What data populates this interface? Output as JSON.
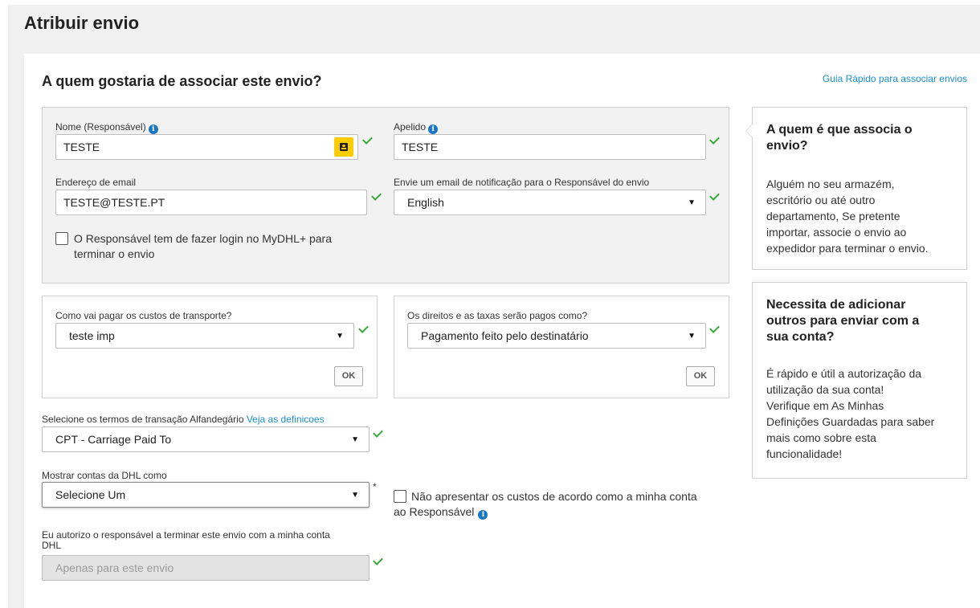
{
  "page": {
    "title": "Atribuir envio"
  },
  "section": {
    "title": "A quem gostaria de associar este envio?",
    "guide_link": "Guia Rápido para associar envios"
  },
  "responsible": {
    "name_label": "Nome (Responsável)",
    "name_value": "TESTE",
    "surname_label": "Apelido",
    "surname_value": "TESTE",
    "email_label": "Endereço de email",
    "email_value": "TESTE@TESTE.PT",
    "notify_label": "Envie um email de notificação para o Responsável do envio",
    "notify_value": "English",
    "login_line1": "O Responsável tem de fazer login no MyDHL+ para",
    "login_line2": "terminar o envio"
  },
  "payment": {
    "transport_label": "Como vai pagar os custos de transporte?",
    "transport_value": "teste imp",
    "duties_label": "Os direitos e as taxas serão pagos como?",
    "duties_value": "Pagamento feito pelo destinatário",
    "ok_label": "OK"
  },
  "customs": {
    "label": "Selecione os termos de transação Alfandegário",
    "link": "Veja as definicoes",
    "value": "CPT - Carriage Paid To"
  },
  "accounts": {
    "label": "Mostrar contas da DHL como",
    "value": "Selecione Um",
    "required_mark": "*",
    "no_costs_line1": "Não apresentar os custos de acordo como a minha conta",
    "no_costs_line2": "ao Responsável"
  },
  "authorize": {
    "label_line1": "Eu autorizo o responsável a terminar este envio com a minha conta",
    "label_line2": "DHL",
    "placeholder": "Apenas para este envio"
  },
  "help1": {
    "title_line1": "A quem é que associa o",
    "title_line2": "envio?",
    "body": [
      "Alguém no seu armazém,",
      "escritório ou até outro",
      "departamento, Se pretente",
      "importar, associe o envio ao",
      "expedidor para terminar o envio."
    ]
  },
  "help2": {
    "title": [
      "Necessita de adicionar",
      "outros para enviar com a",
      "sua conta?"
    ],
    "body": [
      "É rápido e útil a autorização da",
      "utilização da sua conta!",
      "Verifique em As Minhas",
      "Definições Guardadas para saber",
      "mais como sobre esta",
      "funcionalidade!"
    ]
  },
  "icons": {
    "info": "i",
    "arrow": "▼"
  },
  "colors": {
    "brand_yellow": "#ffcc00",
    "link_blue": "#1c8fcf",
    "check_green": "#3aa83a",
    "info_blue": "#1a78c2"
  }
}
